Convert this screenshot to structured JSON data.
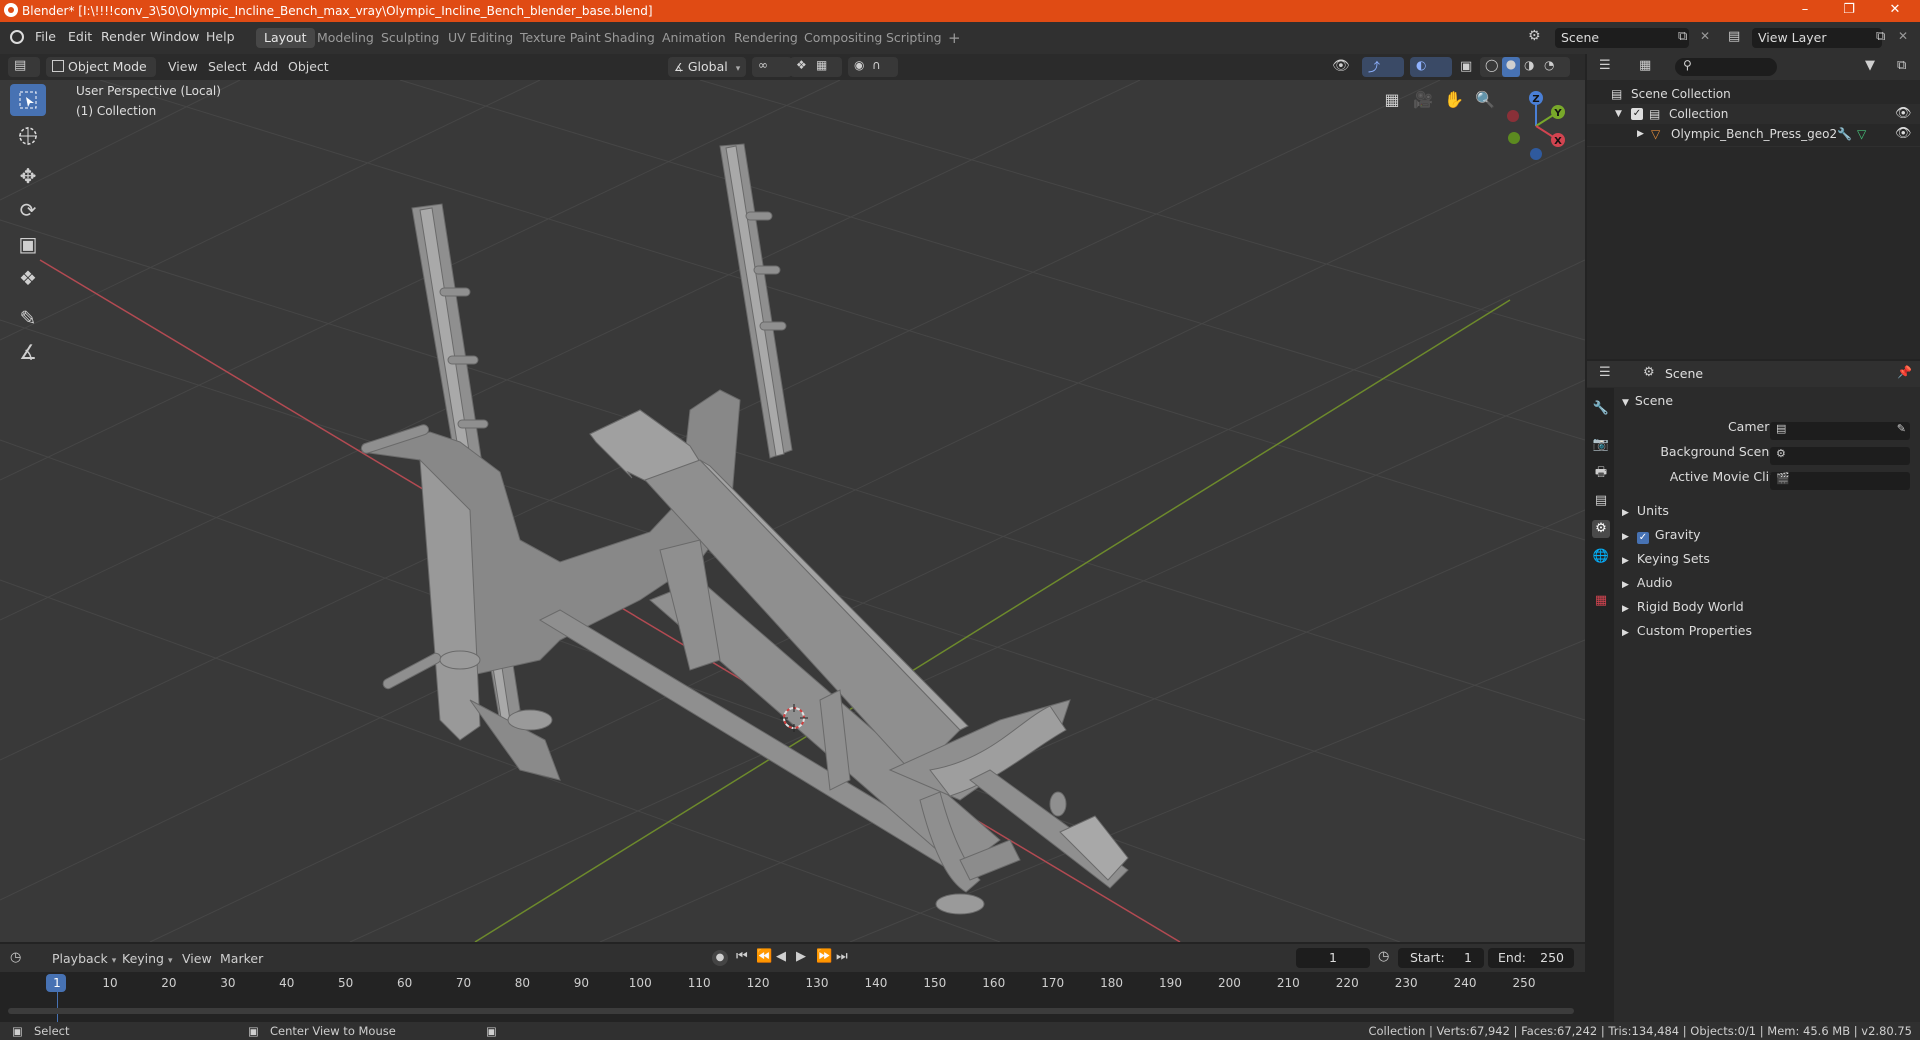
{
  "titlebar": {
    "title": "Blender* [I:\\!!!!conv_3\\50\\Olympic_Incline_Bench_max_vray\\Olympic_Incline_Bench_blender_base.blend]",
    "color": "#e04b14"
  },
  "menubar": {
    "menus": [
      "File",
      "Edit",
      "Render",
      "Window",
      "Help"
    ],
    "workspaces": [
      "Layout",
      "Modeling",
      "Sculpting",
      "UV Editing",
      "Texture Paint",
      "Shading",
      "Animation",
      "Rendering",
      "Compositing",
      "Scripting"
    ],
    "active_workspace": "Layout",
    "add_tab": "+",
    "scene_name": "Scene",
    "view_layer": "View Layer"
  },
  "viewport_header": {
    "mode": "Object Mode",
    "menus": [
      "View",
      "Select",
      "Add",
      "Object"
    ],
    "transform_orientation": "Global"
  },
  "viewport": {
    "perspective": "User Perspective (Local)",
    "collection": "(1) Collection",
    "gizmo_axes": {
      "z": "Z",
      "y": "Y",
      "x": "X"
    },
    "accent": "#4772b3"
  },
  "outliner": {
    "root": "Scene Collection",
    "collection": "Collection",
    "object": "Olympic_Bench_Press_geo2"
  },
  "properties": {
    "context": "Scene",
    "section": "Scene",
    "fields": [
      {
        "label": "Camera"
      },
      {
        "label": "Background Scene"
      },
      {
        "label": "Active Movie Clip"
      }
    ],
    "panels": [
      "Units",
      "Gravity",
      "Keying Sets",
      "Audio",
      "Rigid Body World",
      "Custom Properties"
    ],
    "gravity_checked": true
  },
  "timeline": {
    "menus": [
      "Playback",
      "Keying",
      "View",
      "Marker"
    ],
    "current_frame": "1",
    "start_label": "Start:",
    "start": "1",
    "end_label": "End:",
    "end": "250",
    "ticks": [
      "1",
      "10",
      "20",
      "30",
      "40",
      "50",
      "60",
      "70",
      "80",
      "90",
      "100",
      "110",
      "120",
      "130",
      "140",
      "150",
      "160",
      "170",
      "180",
      "190",
      "200",
      "210",
      "220",
      "230",
      "240",
      "250"
    ]
  },
  "statusbar": {
    "left_action": "Select",
    "middle_action": "Center View to Mouse",
    "stats": "Collection | Verts:67,942 | Faces:67,242 | Tris:134,484 | Objects:0/1 | Mem: 45.6 MB | v2.80.75"
  }
}
